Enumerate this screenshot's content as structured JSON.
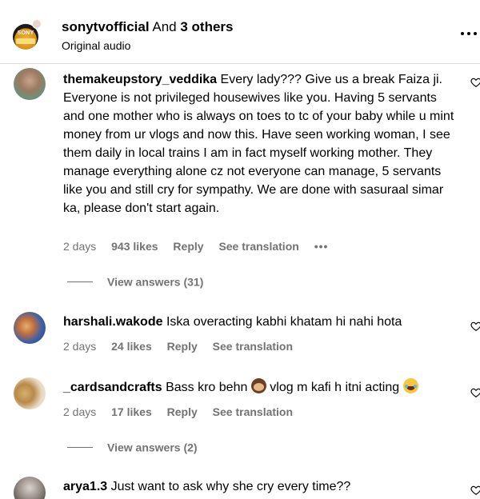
{
  "header": {
    "account": "sonytvofficial",
    "and_text": "And",
    "others": "3 others",
    "subtitle": "Original audio",
    "avatar_text": "SONY"
  },
  "comments": [
    {
      "username": "themakeupstory_veddika",
      "text": "Every lady??? Give us a break Faiza ji. Everyone is not privileged housewives like you. Having 5 servants and one mother who is always on toes to tc of your baby while u mint money from ur vlogs and now this. Have seen working woman, I see them daily in local trains I am in fact myself working mother. They manage everything alone cz not everyone can manage, 5 servants like you and still cry for sympathy. We are done with sasuraal simar ka, please don't start again.",
      "time": "2 days",
      "likes": "943 likes",
      "reply": "Reply",
      "translation": "See translation",
      "more": "•••",
      "view_answers": "View answers (31)"
    },
    {
      "username": "harshali.wakode",
      "text": "Iska overacting kabhi khatam hi nahi hota",
      "time": "2 days",
      "likes": "24 likes",
      "reply": "Reply",
      "translation": "See translation"
    },
    {
      "username": "_cardsandcrafts",
      "text_before": "Bass kro behn",
      "text_middle": "vlog m kafi h itni acting",
      "time": "2 days",
      "likes": "17 likes",
      "reply": "Reply",
      "translation": "See translation",
      "view_answers": "View answers (2)",
      "emojis": [
        "see-no-evil-monkey-icon",
        "tears-of-joy-icon"
      ]
    },
    {
      "username": "arya1.3",
      "text": "Just want to ask why she cry every time??"
    }
  ],
  "colors": {
    "muted": "#737373",
    "divider": "#dbdbdb",
    "text": "#000000"
  }
}
